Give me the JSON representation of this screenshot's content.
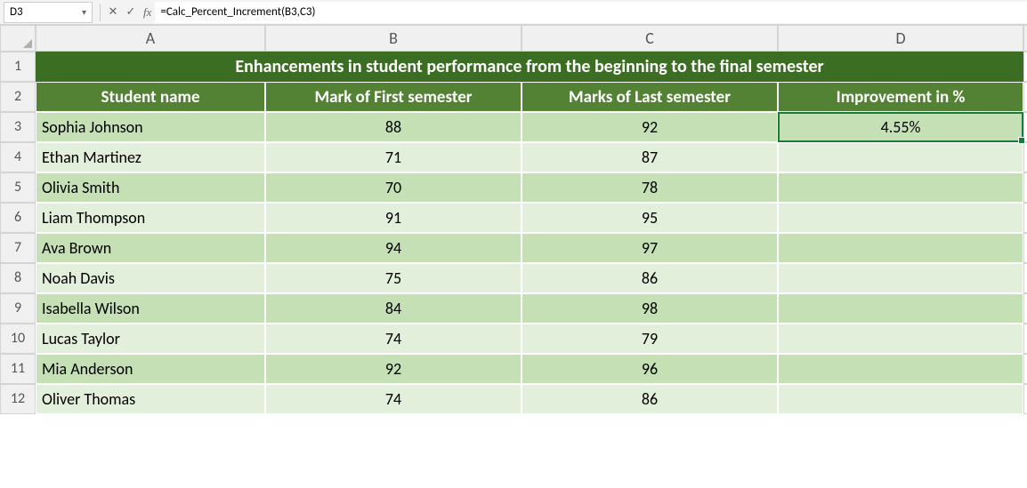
{
  "nameBox": "D3",
  "formula": "=Calc_Percent_Increment(B3,C3)",
  "columns": [
    "A",
    "B",
    "C",
    "D"
  ],
  "title": "Enhancements in student performance from the beginning to the final semester",
  "headers": {
    "name": "Student name",
    "first": "Mark of First semester",
    "last": "Marks of Last semester",
    "improve": "Improvement in %"
  },
  "rows": [
    {
      "n": "3",
      "name": "Sophia Johnson",
      "first": "88",
      "last": "92",
      "improve": "4.55%"
    },
    {
      "n": "4",
      "name": "Ethan Martinez",
      "first": "71",
      "last": "87",
      "improve": ""
    },
    {
      "n": "5",
      "name": "Olivia Smith",
      "first": "70",
      "last": "78",
      "improve": ""
    },
    {
      "n": "6",
      "name": "Liam Thompson",
      "first": "91",
      "last": "95",
      "improve": ""
    },
    {
      "n": "7",
      "name": "Ava Brown",
      "first": "94",
      "last": "97",
      "improve": ""
    },
    {
      "n": "8",
      "name": "Noah Davis",
      "first": "75",
      "last": "86",
      "improve": ""
    },
    {
      "n": "9",
      "name": "Isabella Wilson",
      "first": "84",
      "last": "98",
      "improve": ""
    },
    {
      "n": "10",
      "name": "Lucas Taylor",
      "first": "74",
      "last": "79",
      "improve": ""
    },
    {
      "n": "11",
      "name": "Mia Anderson",
      "first": "92",
      "last": "96",
      "improve": ""
    },
    {
      "n": "12",
      "name": "Oliver Thomas",
      "first": "74",
      "last": "86",
      "improve": ""
    }
  ]
}
